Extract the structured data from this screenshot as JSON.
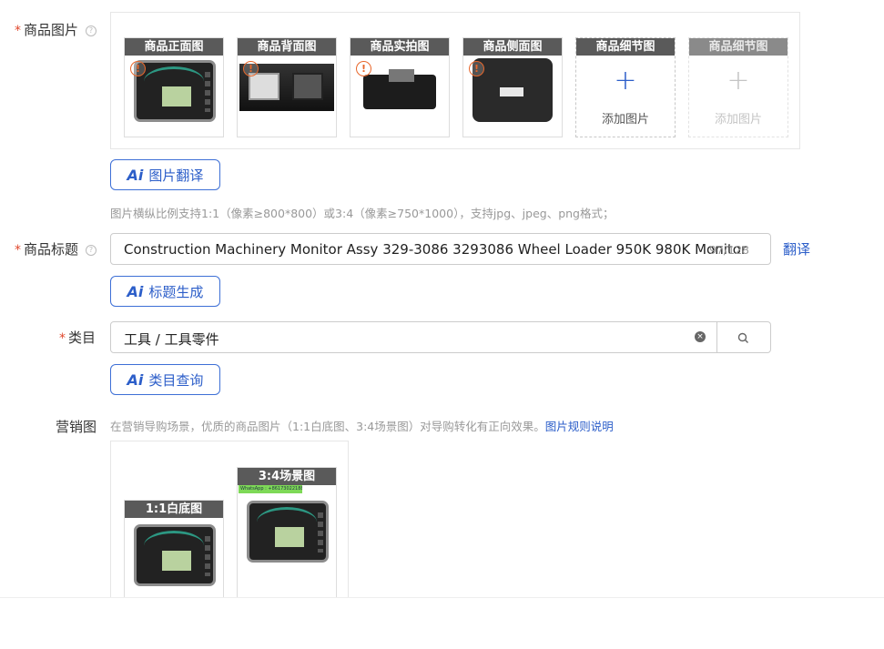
{
  "product_images": {
    "label": "商品图片",
    "required_mark": "*",
    "help_icon": "question-icon",
    "thumbs": [
      {
        "caption": "商品正面图",
        "warning": "!"
      },
      {
        "caption": "商品背面图",
        "warning": "!"
      },
      {
        "caption": "商品实拍图",
        "warning": "!"
      },
      {
        "caption": "商品侧面图",
        "warning": "!"
      }
    ],
    "add_slots": [
      {
        "caption": "商品细节图",
        "plus": "+",
        "text": "添加图片"
      },
      {
        "caption": "商品细节图",
        "plus": "+",
        "text": "添加图片"
      }
    ],
    "ai_button": "图片翻译",
    "ai_icon": "Ai",
    "hint": "图片横纵比例支持1:1（像素≥800*800）或3:4（像素≥750*1000），支持jpg、jpeg、png格式；"
  },
  "product_title": {
    "label": "商品标题",
    "required_mark": "*",
    "value": "Construction Machinery Monitor Assy 329-3086 3293086 Wheel Loader 950K 980K Monitor",
    "count": "97/128",
    "translate_link": "翻译",
    "ai_button": "标题生成",
    "ai_icon": "Ai"
  },
  "category": {
    "label": "类目",
    "required_mark": "*",
    "value": "工具 / 工具零件",
    "ai_button": "类目查询",
    "ai_icon": "Ai"
  },
  "marketing": {
    "label": "营销图",
    "hint": "在营销导购场景，优质的商品图片（1:1白底图、3:4场景图）对导购转化有正向效果。",
    "rules_link": "图片规则说明",
    "images": [
      {
        "caption": "1:1白底图"
      },
      {
        "caption": "3:4场景图",
        "watermark": "WhatsApp : +8617302218825"
      }
    ]
  },
  "colors": {
    "primary": "#2c5ec9",
    "required": "#e0472c",
    "warning": "#e8672b",
    "caption_bg": "#5a5a5a"
  }
}
